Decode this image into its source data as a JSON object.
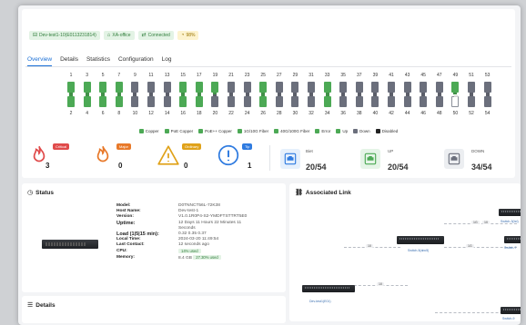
{
  "header": {
    "badges": [
      {
        "icon": "device-icon",
        "label": "Dev-test1-10(E0113231814)",
        "tone": "g"
      },
      {
        "icon": "site-icon",
        "label": "XA-office",
        "tone": "g"
      },
      {
        "icon": "link-icon",
        "label": "Connected",
        "tone": "g"
      },
      {
        "icon": "gauge-icon",
        "label": "98%",
        "tone": "y"
      }
    ]
  },
  "tabs": [
    {
      "label": "Overview",
      "active": true
    },
    {
      "label": "Details",
      "active": false
    },
    {
      "label": "Statistics",
      "active": false
    },
    {
      "label": "Configuration",
      "active": false
    },
    {
      "label": "Log",
      "active": false
    }
  ],
  "ports": {
    "top_numbers": [
      "1",
      "3",
      "5",
      "7",
      "9",
      "11",
      "13",
      "15",
      "17",
      "19",
      "21",
      "23",
      "25",
      "27",
      "29",
      "31",
      "33",
      "35",
      "37",
      "39",
      "41",
      "43",
      "45",
      "47",
      "49",
      "51",
      "53"
    ],
    "bottom_numbers": [
      "2",
      "4",
      "6",
      "8",
      "10",
      "12",
      "14",
      "16",
      "18",
      "20",
      "22",
      "24",
      "26",
      "28",
      "30",
      "32",
      "34",
      "36",
      "38",
      "40",
      "42",
      "44",
      "46",
      "48",
      "50",
      "52",
      "54"
    ],
    "top_states": [
      "green",
      "green",
      "green",
      "green",
      "gray",
      "gray",
      "gray",
      "green",
      "green",
      "green",
      "gray",
      "gray",
      "green",
      "gray",
      "gray",
      "gray",
      "green",
      "gray",
      "gray",
      "gray",
      "gray",
      "gray",
      "gray",
      "gray",
      "green",
      "gray",
      "gray"
    ],
    "bottom_states": [
      "green",
      "green",
      "green",
      "green",
      "gray",
      "gray",
      "gray",
      "green",
      "green",
      "gray",
      "gray",
      "gray",
      "green",
      "gray",
      "gray",
      "gray",
      "green",
      "gray",
      "gray",
      "gray",
      "gray",
      "gray",
      "gray",
      "gray",
      "white",
      "gray",
      "gray"
    ]
  },
  "legend": [
    {
      "label": "Copper",
      "color": "#4ca955"
    },
    {
      "label": "PoE Copper",
      "color": "#4ca955"
    },
    {
      "label": "PoE++ Copper",
      "color": "#4ca955"
    },
    {
      "label": "1G/10G Fiber",
      "color": "#4ca955"
    },
    {
      "label": "40G/100G Fiber",
      "color": "#4ca955"
    },
    {
      "label": "Error",
      "color": "#4ca955"
    },
    {
      "label": "Up",
      "color": "#4ca955"
    },
    {
      "label": "Down",
      "color": "#6b6f7c"
    },
    {
      "label": "Disabled",
      "color": "#222222"
    }
  ],
  "alarms": [
    {
      "tag": "Critical",
      "count": "3",
      "color": "#e04b4b"
    },
    {
      "tag": "Major",
      "count": "0",
      "color": "#e8792a"
    },
    {
      "tag": "Ordinary",
      "count": "0",
      "color": "#e0a21a"
    },
    {
      "tag": "Tip",
      "count": "1",
      "color": "#2f7be0"
    }
  ],
  "links": [
    {
      "title": "Biet",
      "value": "20/54",
      "color": "#2f7be0",
      "bg": "#e6f0fc"
    },
    {
      "title": "UP",
      "value": "20/54",
      "color": "#4ca955",
      "bg": "#e5f4e7"
    },
    {
      "title": "DOWN",
      "value": "34/54",
      "color": "#6b6f7c",
      "bg": "#eceef1"
    }
  ],
  "status": {
    "title": "Status",
    "rows": [
      {
        "k": "Model:",
        "v": "D0TNNCT56L-72K38"
      },
      {
        "k": "Host Name:",
        "v": "Dev-test-1"
      },
      {
        "k": "Version:",
        "v": "V1.0.1R0P4-S2-YMDFTSTTRT5E0"
      },
      {
        "k": "Uptime:",
        "v": "12 Days 11 Hours 22 Minutes 11",
        "v2": "Seconds",
        "big": true
      },
      {
        "k": "Load (1|5|15 min):",
        "v": "0.32  0.35  0.37",
        "big": true
      },
      {
        "k": "Local Time:",
        "v": "2024-03-20 11:49:54"
      },
      {
        "k": "Last Contact:",
        "v": "12 seconds ago"
      },
      {
        "k": "CPU:",
        "chip": "14% used"
      },
      {
        "k": "Memory:",
        "v": "8.4 GB",
        "chip": "27.30% used"
      }
    ]
  },
  "assoc": {
    "title": "Associated Link",
    "nodes": [
      {
        "label": "Switch-5(abc5)"
      },
      {
        "label": "Switch-3(bd)"
      },
      {
        "label": "Switch-7"
      },
      {
        "label": "Switch-9"
      },
      {
        "label": "Dev-test1(E01)"
      }
    ],
    "pills": [
      "10",
      "1G",
      "10",
      "1G",
      "10"
    ]
  },
  "details": {
    "title": "Details"
  }
}
